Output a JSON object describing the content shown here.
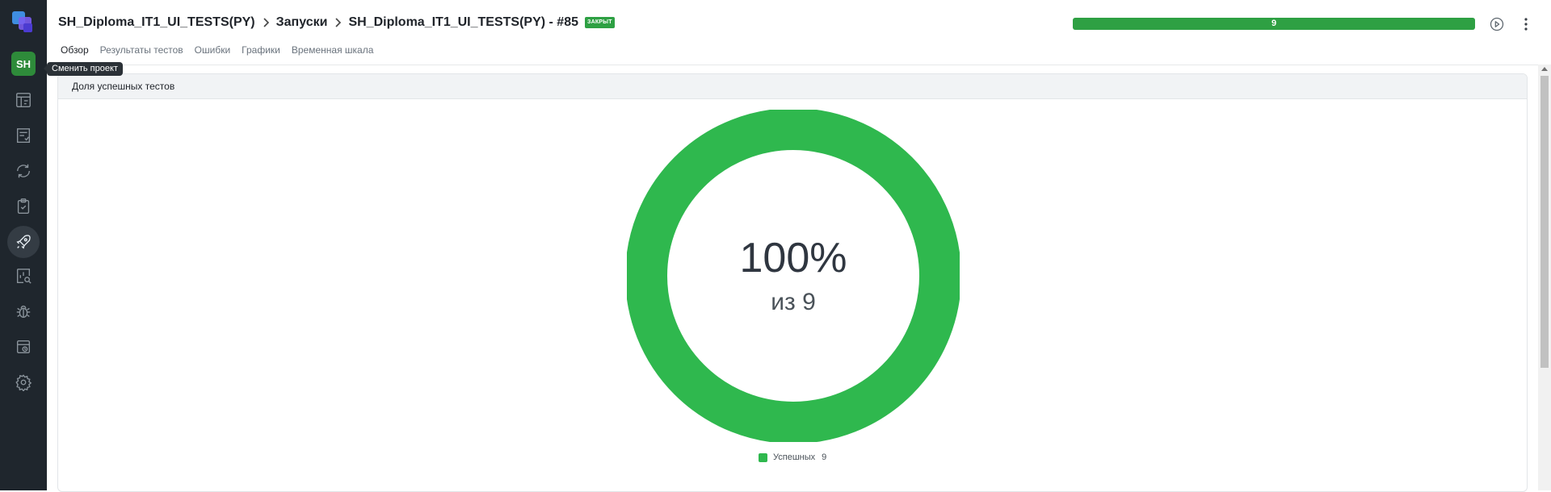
{
  "sidebar": {
    "project_initials": "SH",
    "tooltip": "Сменить проект",
    "items": [
      {
        "icon": "dashboard-icon"
      },
      {
        "icon": "test-cases-icon"
      },
      {
        "icon": "sync-icon"
      },
      {
        "icon": "checklist-icon"
      },
      {
        "icon": "rocket-icon",
        "active": true
      },
      {
        "icon": "analytics-search-icon"
      },
      {
        "icon": "bug-icon"
      },
      {
        "icon": "environment-icon"
      },
      {
        "icon": "gear-icon"
      }
    ]
  },
  "header": {
    "breadcrumb": {
      "project": "SH_Diploma_IT1_UI_TESTS(PY)",
      "section": "Запуски",
      "launch": "SH_Diploma_IT1_UI_TESTS(PY) - #85"
    },
    "status_badge": "ЗАКРЫТ",
    "progress": {
      "label": "9",
      "passed_fraction": 1.0,
      "color": "#2ea043"
    },
    "tabs": [
      {
        "label": "Обзор",
        "active": true
      },
      {
        "label": "Результаты тестов"
      },
      {
        "label": "Ошибки"
      },
      {
        "label": "Графики"
      },
      {
        "label": "Временная шкала"
      }
    ]
  },
  "card": {
    "title": "Доля успешных тестов",
    "center_percent": "100%",
    "center_total": "из 9"
  },
  "chart_data": {
    "type": "pie",
    "title": "Доля успешных тестов",
    "categories": [
      "Успешных"
    ],
    "values": [
      9
    ],
    "colors": [
      "#2fb84e"
    ],
    "legend": "bottom"
  }
}
